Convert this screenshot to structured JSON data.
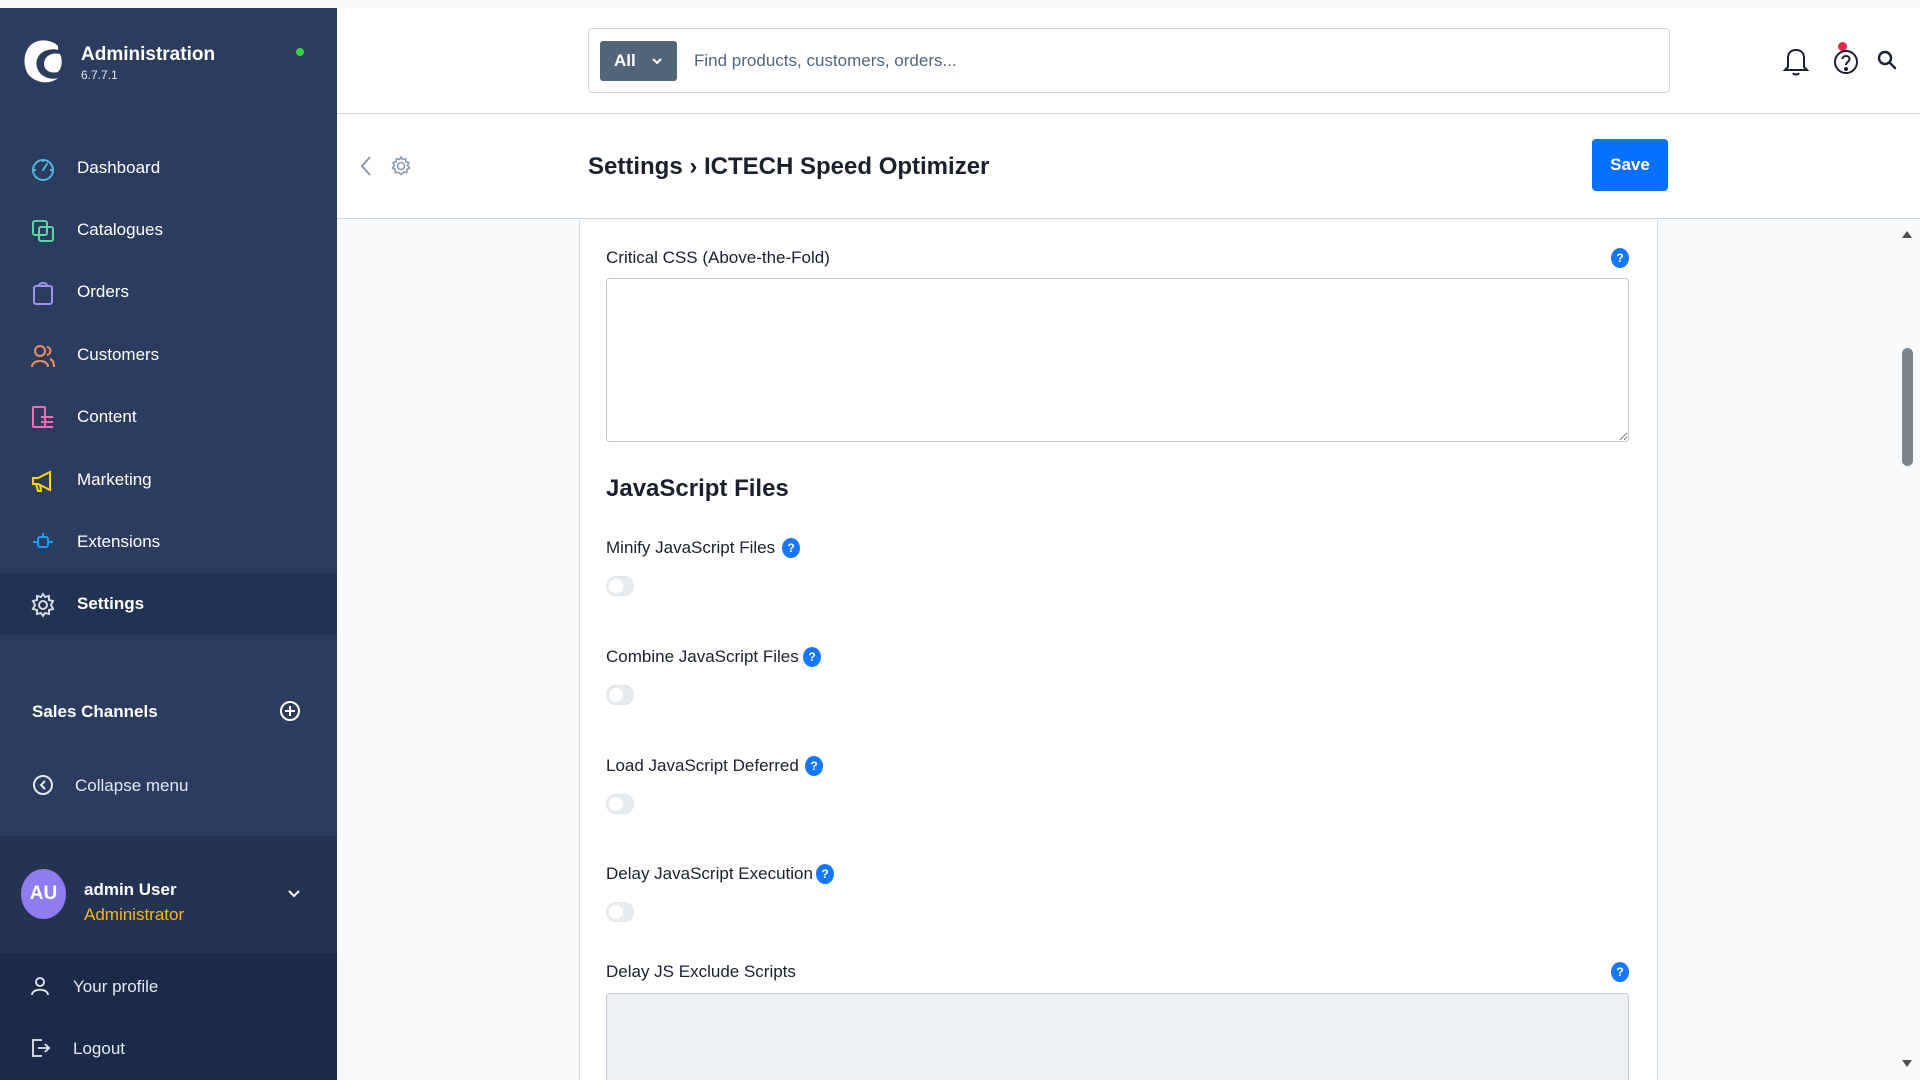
{
  "app": {
    "title": "Administration",
    "version": "6.7.7.1",
    "status_color": "#37d046"
  },
  "sidebar": {
    "items": [
      {
        "label": "Dashboard",
        "icon": "dashboard-icon",
        "color": "#52b8e0"
      },
      {
        "label": "Catalogues",
        "icon": "catalogues-icon",
        "color": "#57d9a3"
      },
      {
        "label": "Orders",
        "icon": "orders-icon",
        "color": "#a092f0"
      },
      {
        "label": "Customers",
        "icon": "customers-icon",
        "color": "#f88962"
      },
      {
        "label": "Content",
        "icon": "content-icon",
        "color": "#ff68b4"
      },
      {
        "label": "Marketing",
        "icon": "marketing-icon",
        "color": "#ffd700"
      },
      {
        "label": "Extensions",
        "icon": "extensions-icon",
        "color": "#189eff"
      },
      {
        "label": "Settings",
        "icon": "settings-icon",
        "color": "#d1d9e0",
        "active": true
      }
    ],
    "sales_channels_label": "Sales Channels",
    "collapse_label": "Collapse menu",
    "user": {
      "initials": "AU",
      "name": "admin User",
      "role": "Administrator"
    },
    "bottom": [
      {
        "label": "Your profile",
        "icon": "user-icon"
      },
      {
        "label": "Logout",
        "icon": "logout-icon"
      }
    ]
  },
  "search": {
    "type_label": "All",
    "placeholder": "Find products, customers, orders..."
  },
  "smartbar": {
    "title": "Settings › ICTECH Speed Optimizer",
    "save_label": "Save"
  },
  "form": {
    "critical_css_label": "Critical CSS (Above-the-Fold)",
    "js_section_title": "JavaScript Files",
    "toggles": [
      {
        "label": "Minify JavaScript Files",
        "enabled": false
      },
      {
        "label": "Combine JavaScript Files",
        "enabled": false
      },
      {
        "label": "Load JavaScript Deferred",
        "enabled": false
      },
      {
        "label": "Delay JavaScript Execution",
        "enabled": false
      }
    ],
    "delay_exclude_label": "Delay JS Exclude Scripts",
    "help_glyph": "?"
  },
  "colors": {
    "primary": "#0870ff",
    "sidebar_bg": "#2a3d5e",
    "user_role": "#ffb31d",
    "notification": "#de294c"
  }
}
